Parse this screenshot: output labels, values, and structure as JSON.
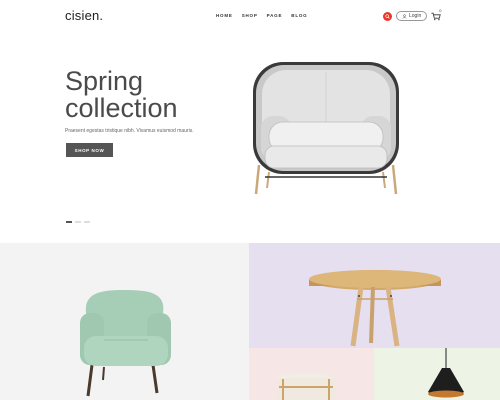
{
  "header": {
    "logo": "cisien.",
    "nav": [
      "HOME",
      "SHOP",
      "PAGE",
      "BLOG"
    ],
    "login_label": "Login",
    "cart_count": "0"
  },
  "hero": {
    "title_line1": "Spring",
    "title_line2": "collection",
    "subtitle": "Praesent egestas tristique nibh. Vivamus euismod mauris.",
    "cta_label": "SHOP NOW",
    "slides_total": 3,
    "slide_active": 1
  },
  "colors": {
    "accent_red": "#e8382e",
    "button_dark": "#555555",
    "tile_grey": "#f3f3f3",
    "tile_lavender": "#e5dff0",
    "tile_pink": "#f6e6e6",
    "tile_green": "#edf3e5"
  },
  "icons": [
    "search-icon",
    "user-icon",
    "cart-icon"
  ]
}
